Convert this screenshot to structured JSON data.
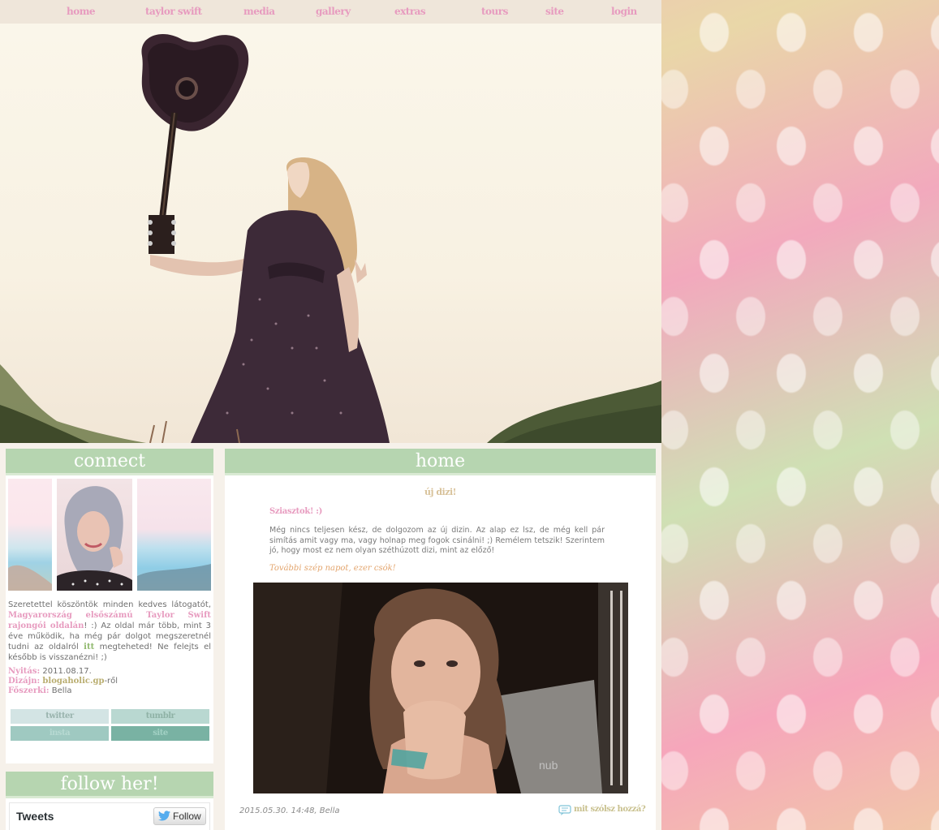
{
  "nav": {
    "items": [
      "home",
      "taylor swift",
      "media",
      "gallery",
      "extras",
      "tours",
      "site",
      "login"
    ]
  },
  "sidebar": {
    "connect_title": "connect",
    "intro": {
      "part1": "Szeretettel köszöntök minden kedves látogatót, ",
      "highlight": "Magyarország elsőszámú Taylor Swift rajongói oldalán",
      "part2": "! :) Az oldal már több, mint 3 éve működik, ha még pár dolgot megszeretnél tudni az oldalról ",
      "link": "itt",
      "part3": " megteheted! Ne felejts el később is visszanézni! ;)"
    },
    "meta": {
      "opened_label": "Nyitás:",
      "opened_value": "2011.08.17.",
      "design_label": "Dizájn:",
      "design_value": "blogaholic.gp",
      "design_suffix": "-ről",
      "editor_label": "Főszerki:",
      "editor_value": "Bella"
    },
    "social_buttons": [
      "twitter",
      "tumblr",
      "insta",
      "site"
    ],
    "follow_title": "follow her!",
    "tweets_label": "Tweets",
    "follow_button": "Follow"
  },
  "main": {
    "title": "home",
    "post_title": "új dizi!",
    "greeting": "Sziasztok! :)",
    "body": "Még nincs teljesen kész, de dolgozom az új dizin. Az alap ez lsz, de még kell pár simítás amit vagy ma, vagy holnap meg fogok csinálni! ;) Remélem tetszik! Szerintem jó, hogy most ez nem olyan széthúzott dizi, mint az előző!",
    "signoff": "További szép napot, ezer csók!",
    "image_watermark": "nub",
    "date": "2015.05.30. 14:48, Bella",
    "comment_link": "mit szólsz hozzá?"
  },
  "colors": {
    "accent_green": "#b6d5b0",
    "accent_pink": "#e79bbf",
    "nav_bg": "#efe6da"
  }
}
